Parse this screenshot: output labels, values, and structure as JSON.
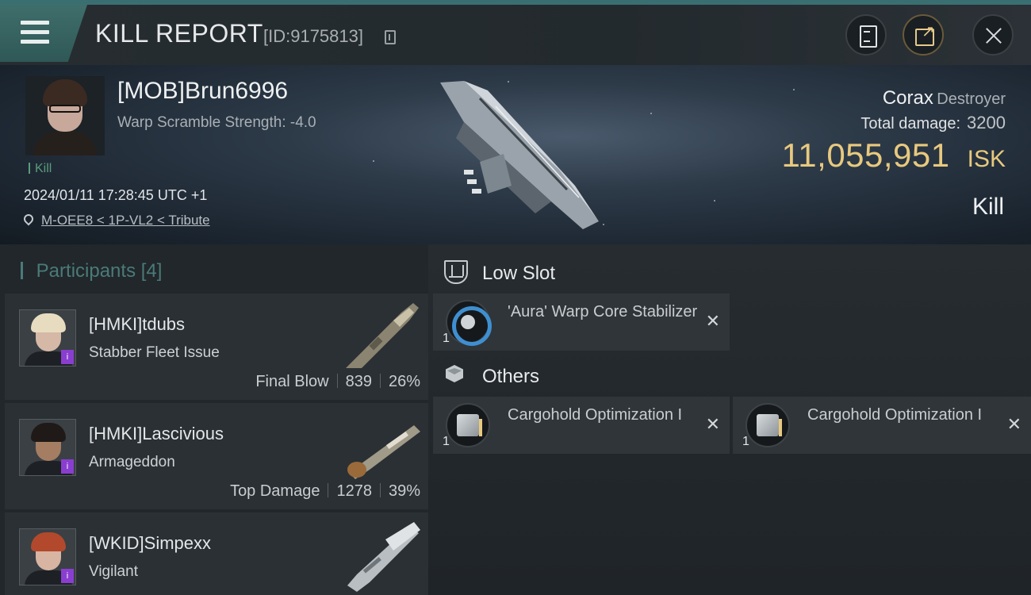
{
  "header": {
    "title": "KILL REPORT",
    "report_id": "[ID:9175813]"
  },
  "victim": {
    "name": "[MOB]Brun6996",
    "warp_scramble": "Warp Scramble Strength: -4.0",
    "kill_tag": "Kill",
    "timestamp": "2024/01/11 17:28:45 UTC +1",
    "location": "M-OEE8 < 1P-VL2 < Tribute",
    "ship_name": "Corax",
    "ship_class": "Destroyer",
    "total_damage_label": "Total damage:",
    "total_damage_value": "3200",
    "isk_value": "11,055,951",
    "isk_unit": "ISK",
    "result_label": "Kill"
  },
  "participants": {
    "label": "Participants",
    "count": "[4]",
    "items": [
      {
        "name": "[HMKI]tdubs",
        "ship": "Stabber Fleet Issue",
        "role": "Final Blow",
        "damage": "839",
        "percent": "26%",
        "hair": "#e7dcc0",
        "skin": "#d6b8a6"
      },
      {
        "name": "[HMKI]Lascivious",
        "ship": "Armageddon",
        "role": "Top Damage",
        "damage": "1278",
        "percent": "39%",
        "hair": "#1f1a18",
        "skin": "#a57d62"
      },
      {
        "name": "[WKID]Simpexx",
        "ship": "Vigilant",
        "role": "",
        "damage": "",
        "percent": "",
        "hair": "#b2492c",
        "skin": "#d8b4a2"
      }
    ]
  },
  "modules": {
    "low_slot": {
      "label": "Low Slot",
      "items": [
        {
          "qty": "1",
          "name": "'Aura' Warp Core Stabilizer",
          "icon": "warp-core-stabilizer-icon"
        }
      ]
    },
    "others": {
      "label": "Others",
      "items": [
        {
          "qty": "1",
          "name": "Cargohold Optimization I",
          "icon": "cargohold-optimization-icon"
        },
        {
          "qty": "1",
          "name": "Cargohold Optimization I",
          "icon": "cargohold-optimization-icon"
        }
      ]
    }
  },
  "colors": {
    "accent": "#3a6f72",
    "isk": "#e8c97e",
    "participants_header": "#4b7a78",
    "badge": "#8a3ed0"
  }
}
